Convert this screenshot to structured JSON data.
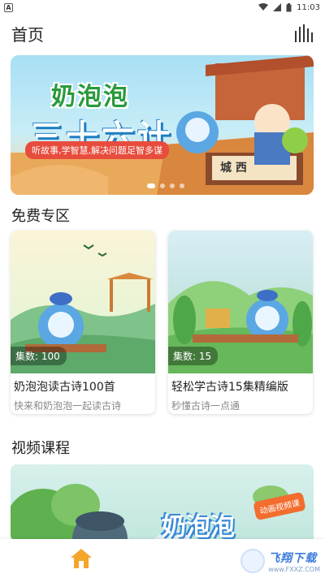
{
  "status_bar": {
    "time": "11:03",
    "left_icon": "A"
  },
  "header": {
    "title": "首页",
    "chart_icon": "bar-chart-icon"
  },
  "banner": {
    "title": "奶泡泡",
    "subtitle": "三十六计",
    "tagline": "听故事,学智慧,解决问题足智多谋",
    "sign_text": "城 西",
    "dots": 4
  },
  "free_section": {
    "title": "免费专区",
    "cards": [
      {
        "count_label": "集数: 100",
        "name": "奶泡泡读古诗100首",
        "desc": "快来和奶泡泡一起读古诗"
      },
      {
        "count_label": "集数: 15",
        "name": "轻松学古诗15集精编版",
        "desc": "秒懂古诗一点通"
      }
    ]
  },
  "video_section": {
    "title": "视频课程",
    "tag": "动画视频课",
    "banner_title": "奶泡泡"
  },
  "bottom_nav": {
    "home_icon": "home-icon"
  },
  "watermark": {
    "main": "飞翔下载",
    "sub": "www.FXXZ.COM"
  }
}
